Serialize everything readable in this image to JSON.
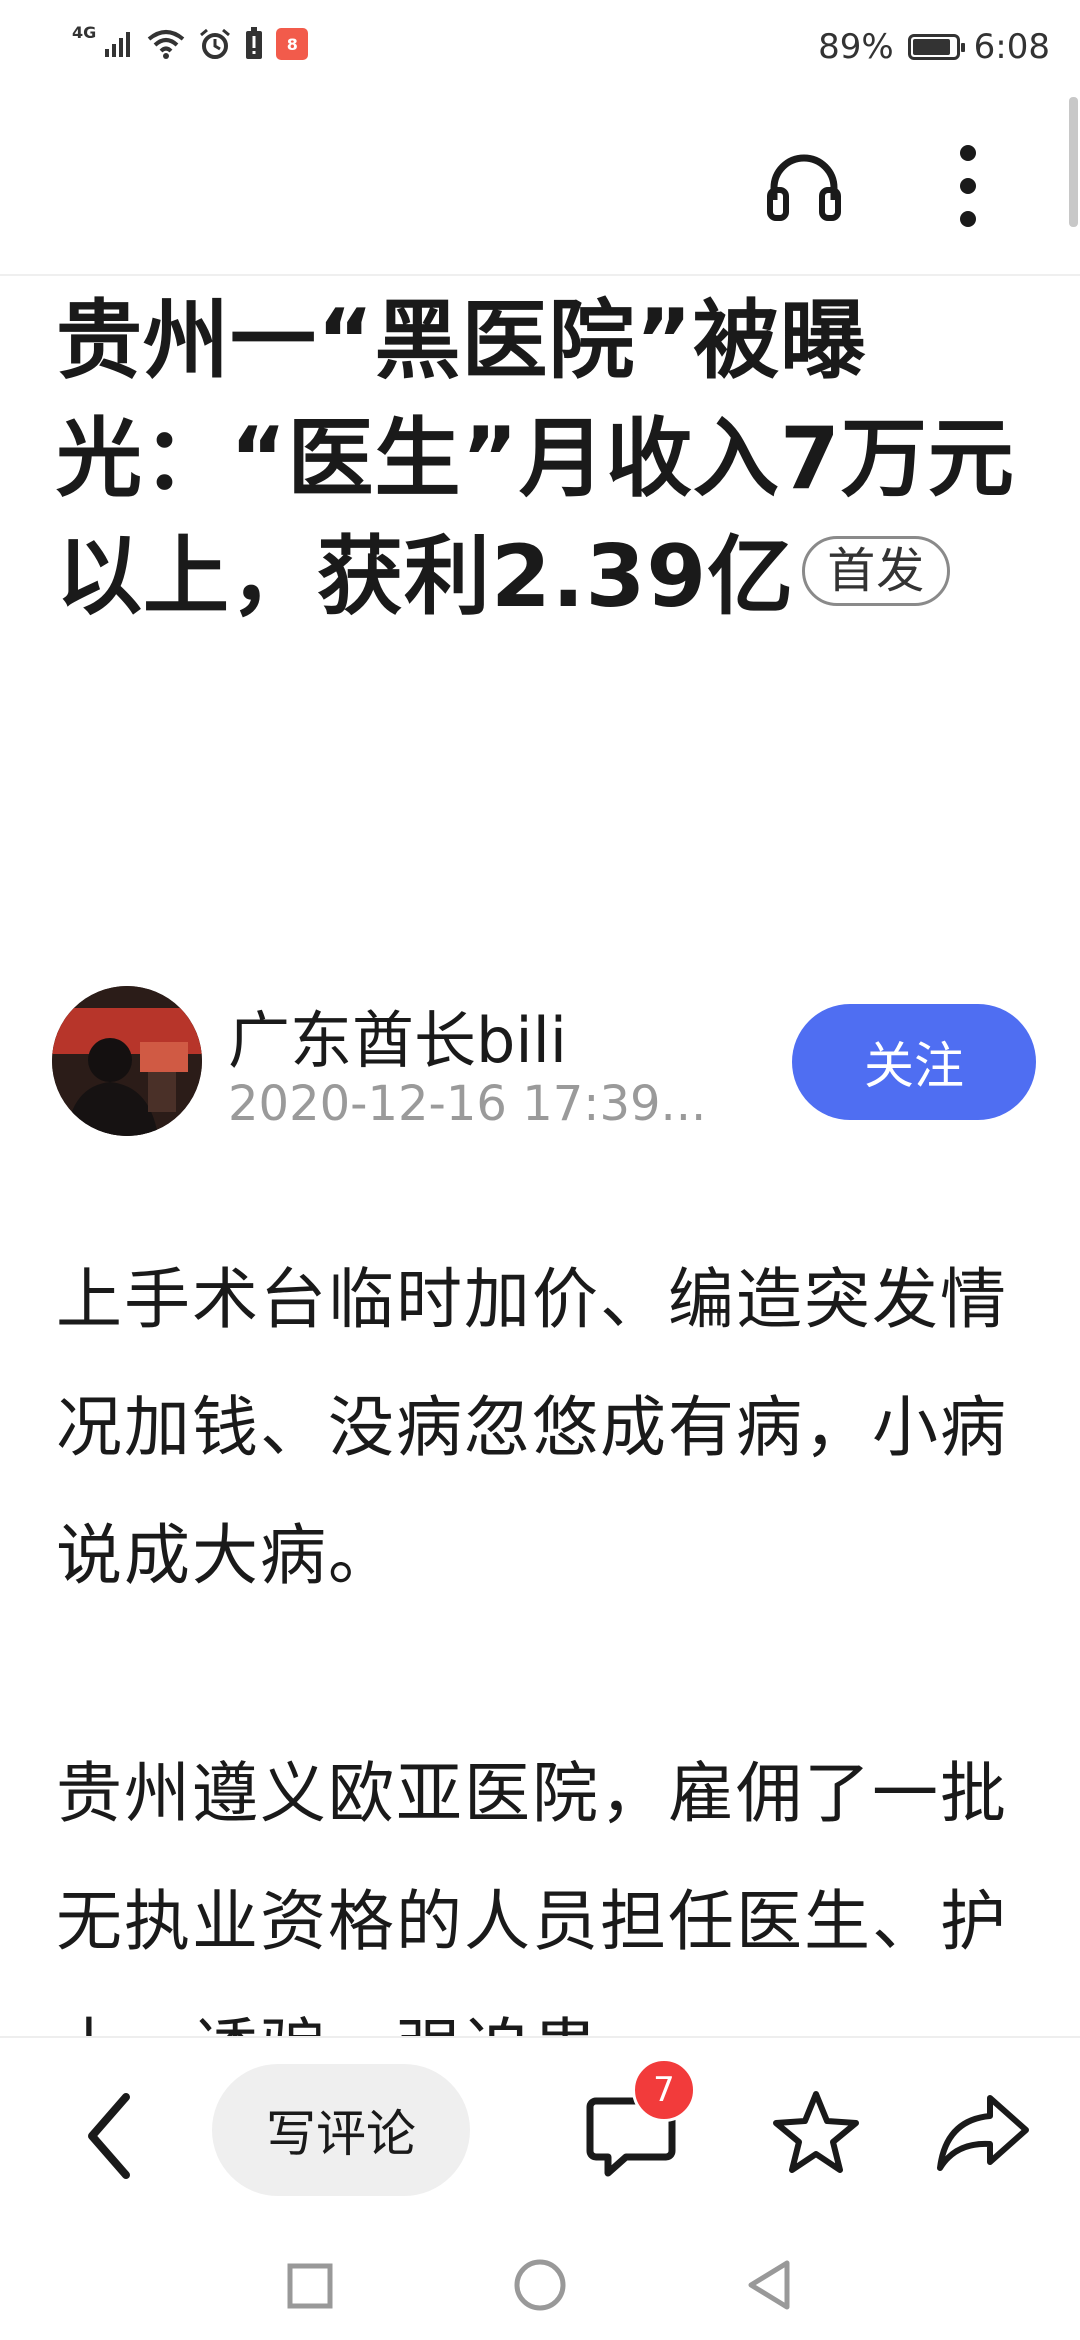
{
  "status_bar": {
    "network": "4G",
    "app_badge": "8",
    "battery_percent": "89%",
    "battery_level": 0.89,
    "time": "6:08"
  },
  "toolbar": {
    "listen_icon": "headphones-icon",
    "more_icon": "more-vertical-icon"
  },
  "article": {
    "title": "贵州一“黑医院”被曝光：“医生”月收入7万元以上，获利2.39亿",
    "first_badge": "首发",
    "author": {
      "name": "广东酋长bili",
      "meta": "2020-12-16 17:39...",
      "follow_label": "关注"
    },
    "paragraphs": [
      "上手术台临时加价、编造突发情况加钱、没病忽悠成有病，小病说成大病。",
      "贵州遵义欧亚医院，雇佣了一批无执业资格的人员担任医生、护士，诱骗、强迫患"
    ]
  },
  "bottom_bar": {
    "back_icon": "back-chevron-icon",
    "comment_placeholder": "写评论",
    "comment_count": "7",
    "comment_icon": "comment-bubble-icon",
    "favorite_icon": "star-icon",
    "share_icon": "share-arrow-icon"
  },
  "nav_bar": {
    "recent_icon": "square-icon",
    "home_icon": "circle-icon",
    "back_icon": "triangle-back-icon"
  },
  "colors": {
    "follow_button": "#4f6ef2",
    "badge_red": "#f23b3b",
    "meta_gray": "#9a9a9a"
  }
}
